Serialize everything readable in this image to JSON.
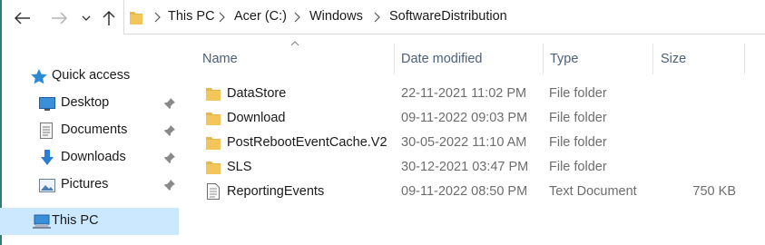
{
  "navigation": {
    "back": "back-arrow-icon",
    "forward": "forward-arrow-icon",
    "recent": "chevron-down-icon",
    "up": "up-arrow-icon"
  },
  "breadcrumb": [
    "This PC",
    "Acer (C:)",
    "Windows",
    "SoftwareDistribution"
  ],
  "sidebar": {
    "items": [
      {
        "label": "Quick access",
        "icon": "star-icon"
      },
      {
        "label": "Desktop",
        "icon": "desktop-icon",
        "pinned": true
      },
      {
        "label": "Documents",
        "icon": "documents-icon",
        "pinned": true
      },
      {
        "label": "Downloads",
        "icon": "download-icon",
        "pinned": true
      },
      {
        "label": "Pictures",
        "icon": "pictures-icon",
        "pinned": true
      },
      {
        "label": "This PC",
        "icon": "computer-icon",
        "selected": true
      }
    ]
  },
  "columns": [
    "Name",
    "Date modified",
    "Type",
    "Size"
  ],
  "files": [
    {
      "name": "DataStore",
      "date": "22-11-2021 11:02 PM",
      "type": "File folder",
      "size": "",
      "icon": "folder-icon"
    },
    {
      "name": "Download",
      "date": "09-11-2022 09:03 PM",
      "type": "File folder",
      "size": "",
      "icon": "folder-icon"
    },
    {
      "name": "PostRebootEventCache.V2",
      "date": "30-05-2022 11:10 AM",
      "type": "File folder",
      "size": "",
      "icon": "folder-icon"
    },
    {
      "name": "SLS",
      "date": "30-12-2021 03:47 PM",
      "type": "File folder",
      "size": "",
      "icon": "folder-icon"
    },
    {
      "name": "ReportingEvents",
      "date": "09-11-2022 08:50 PM",
      "type": "Text Document",
      "size": "750 KB",
      "icon": "text-document-icon"
    }
  ],
  "colors": {
    "accent": "#0078d7",
    "folder": "#e8b64b",
    "selection": "#cce8ff",
    "header_text": "#4c607a",
    "secondary_text": "#6d6d6d"
  }
}
